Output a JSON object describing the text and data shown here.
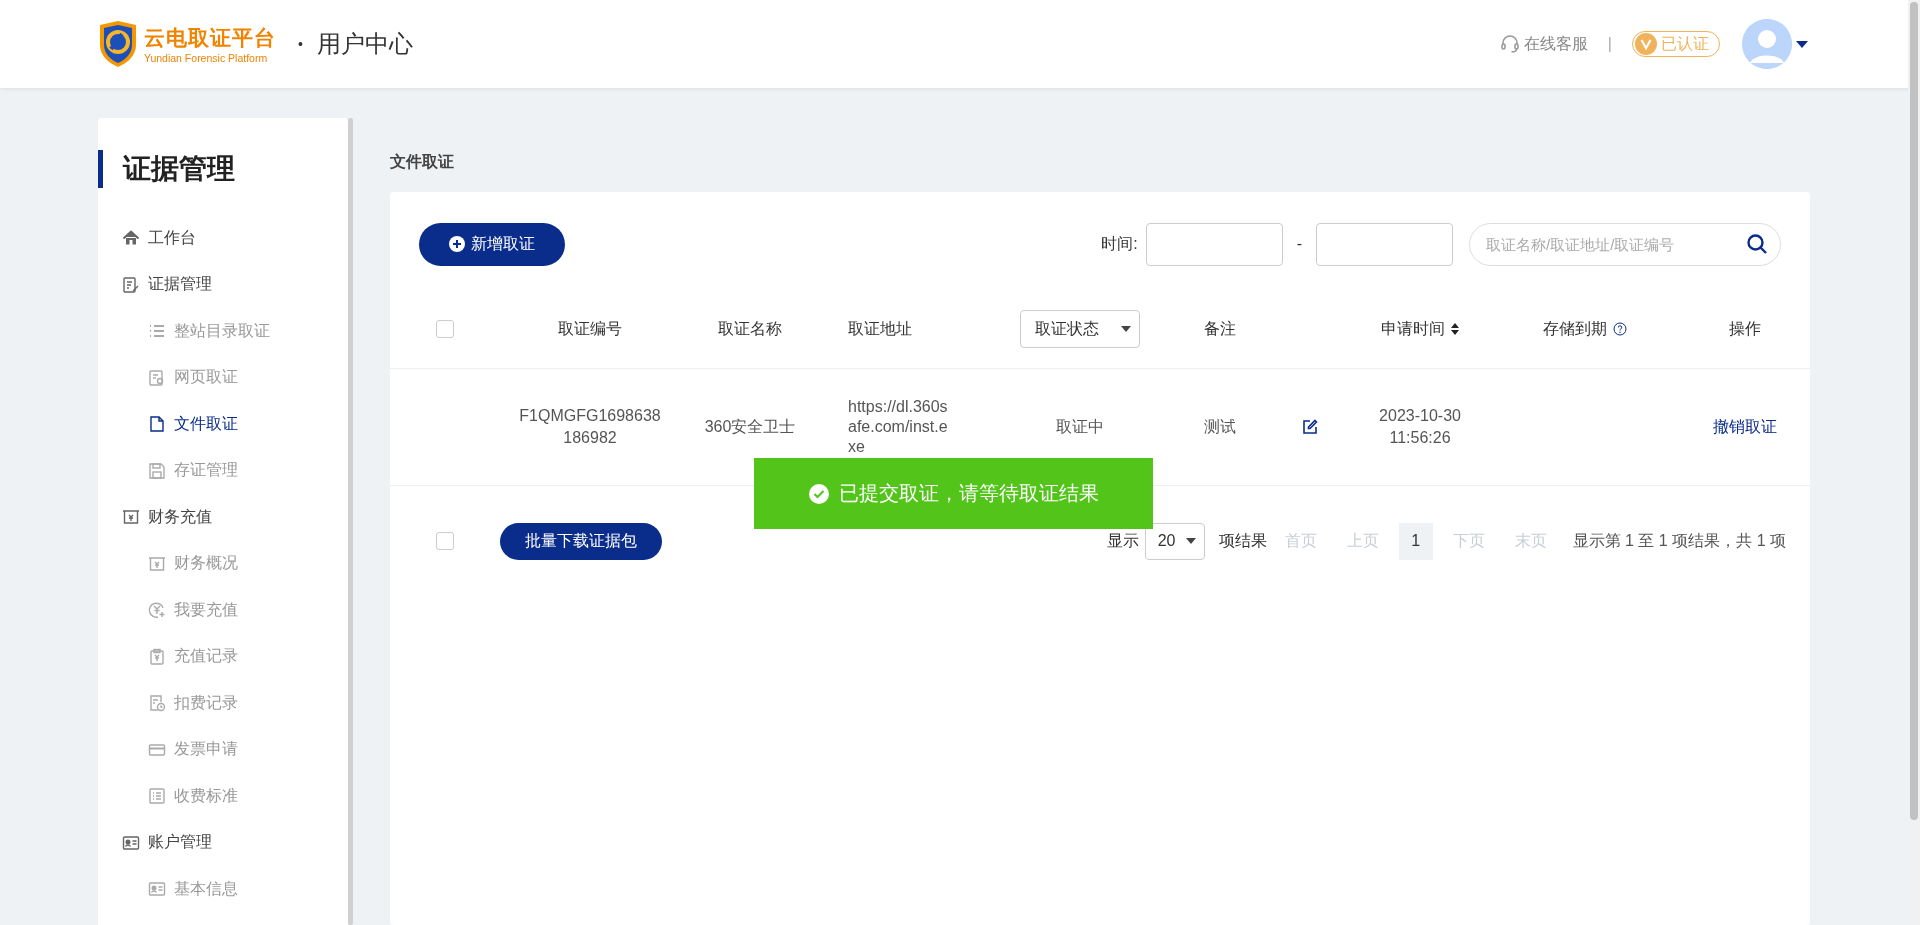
{
  "header": {
    "logo_title": "云电取证平台",
    "logo_subtitle": "Yundian Forensic Platform",
    "separator": "•",
    "section": "用户中心",
    "support": "在线客服",
    "divider": "|",
    "verified_badge": "已认证"
  },
  "sidebar": {
    "title": "证据管理",
    "items": [
      {
        "label": "工作台",
        "selected": false
      },
      {
        "label": "证据管理",
        "selected": false,
        "children": [
          {
            "label": "整站目录取证",
            "selected": false
          },
          {
            "label": "网页取证",
            "selected": false
          },
          {
            "label": "文件取证",
            "selected": true
          },
          {
            "label": "存证管理",
            "selected": false
          }
        ]
      },
      {
        "label": "财务充值",
        "selected": false,
        "children": [
          {
            "label": "财务概况",
            "selected": false
          },
          {
            "label": "我要充值",
            "selected": false
          },
          {
            "label": "充值记录",
            "selected": false
          },
          {
            "label": "扣费记录",
            "selected": false
          },
          {
            "label": "发票申请",
            "selected": false
          },
          {
            "label": "收费标准",
            "selected": false
          }
        ]
      },
      {
        "label": "账户管理",
        "selected": false,
        "children": [
          {
            "label": "基本信息",
            "selected": false
          }
        ]
      }
    ]
  },
  "page_title": "文件取证",
  "toolbar": {
    "new_button": "新增取证",
    "time_label": "时间:",
    "date_separator": "-",
    "search_placeholder": "取证名称/取证地址/取证编号"
  },
  "table": {
    "select_all": {
      "checked": false
    },
    "columns": [
      {
        "label": "取证编号",
        "kind": "text"
      },
      {
        "label": "取证名称",
        "kind": "text"
      },
      {
        "label": "取证地址",
        "kind": "text"
      },
      {
        "label": "取证状态",
        "kind": "dropdown"
      },
      {
        "label": "备注",
        "kind": "text"
      },
      {
        "label": "申请时间",
        "kind": "sortable"
      },
      {
        "label": "存储到期",
        "kind": "help"
      },
      {
        "label": "操作",
        "kind": "text"
      }
    ],
    "rows": [
      {
        "id": "F1QMGFG1698638186982",
        "name": "360安全卫士",
        "url": "https://dl.360safe.com/inst.exe",
        "status": "取证中",
        "note": "测试",
        "time": "2023-10-30 11:56:26",
        "action": "撤销取证"
      }
    ]
  },
  "footer": {
    "select_all": {
      "checked": false
    },
    "batch_button": "批量下载证据包",
    "show_label": "显示",
    "page_size": "20",
    "items_label": "项结果",
    "pages": [
      {
        "label": "首页",
        "disabled": true,
        "selected": false
      },
      {
        "label": "上页",
        "disabled": true,
        "selected": false
      },
      {
        "label": "1",
        "disabled": false,
        "selected": true
      },
      {
        "label": "下页",
        "disabled": true,
        "selected": false
      },
      {
        "label": "末页",
        "disabled": true,
        "selected": false
      }
    ],
    "summary": "显示第 1 至 1 项结果，共 1 项"
  },
  "toast": {
    "message": "已提交取证，请等待取证结果"
  }
}
